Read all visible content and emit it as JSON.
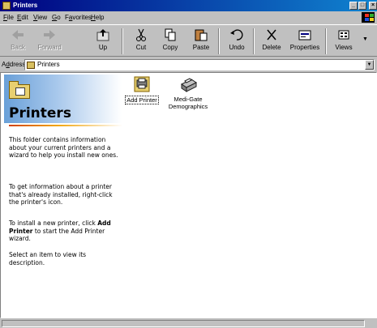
{
  "window": {
    "title": "Printers",
    "controls": {
      "minimize": "_",
      "maximize": "□",
      "close": "×"
    }
  },
  "menu": {
    "items": [
      {
        "u": "F",
        "rest": "ile"
      },
      {
        "u": "E",
        "rest": "dit"
      },
      {
        "u": "V",
        "rest": "iew"
      },
      {
        "u": "G",
        "rest": "o"
      },
      {
        "pre": "F",
        "u": "a",
        "rest": "vorites"
      },
      {
        "u": "H",
        "rest": "elp"
      }
    ]
  },
  "toolbar": {
    "back": "Back",
    "forward": "Forward",
    "up": "Up",
    "cut": "Cut",
    "copy": "Copy",
    "paste": "Paste",
    "undo": "Undo",
    "delete": "Delete",
    "properties": "Properties",
    "views": "Views"
  },
  "address": {
    "label_u": "d",
    "label_pre": "A",
    "label_rest": "dress",
    "value": "Printers"
  },
  "left_pane": {
    "title": "Printers",
    "para1": "This folder contains information about your current printers and a wizard to help you install new ones.",
    "para2": "To get information about a printer that's already installed, right-click the printer's icon.",
    "para3_pre": "To install a new printer, click ",
    "para3_bold": "Add Printer",
    "para3_post": " to start the Add Printer wizard.",
    "para4": "Select an item to view its description."
  },
  "items": [
    {
      "label": "Add Printer",
      "icon": "add-printer-icon",
      "selected": true
    },
    {
      "label_line1": "Medi-Gate",
      "label_line2": "Demographics",
      "icon": "printer-icon",
      "selected": false
    }
  ],
  "colors": {
    "title_start": "#000080",
    "title_end": "#1084d0",
    "face": "#c0c0c0"
  }
}
